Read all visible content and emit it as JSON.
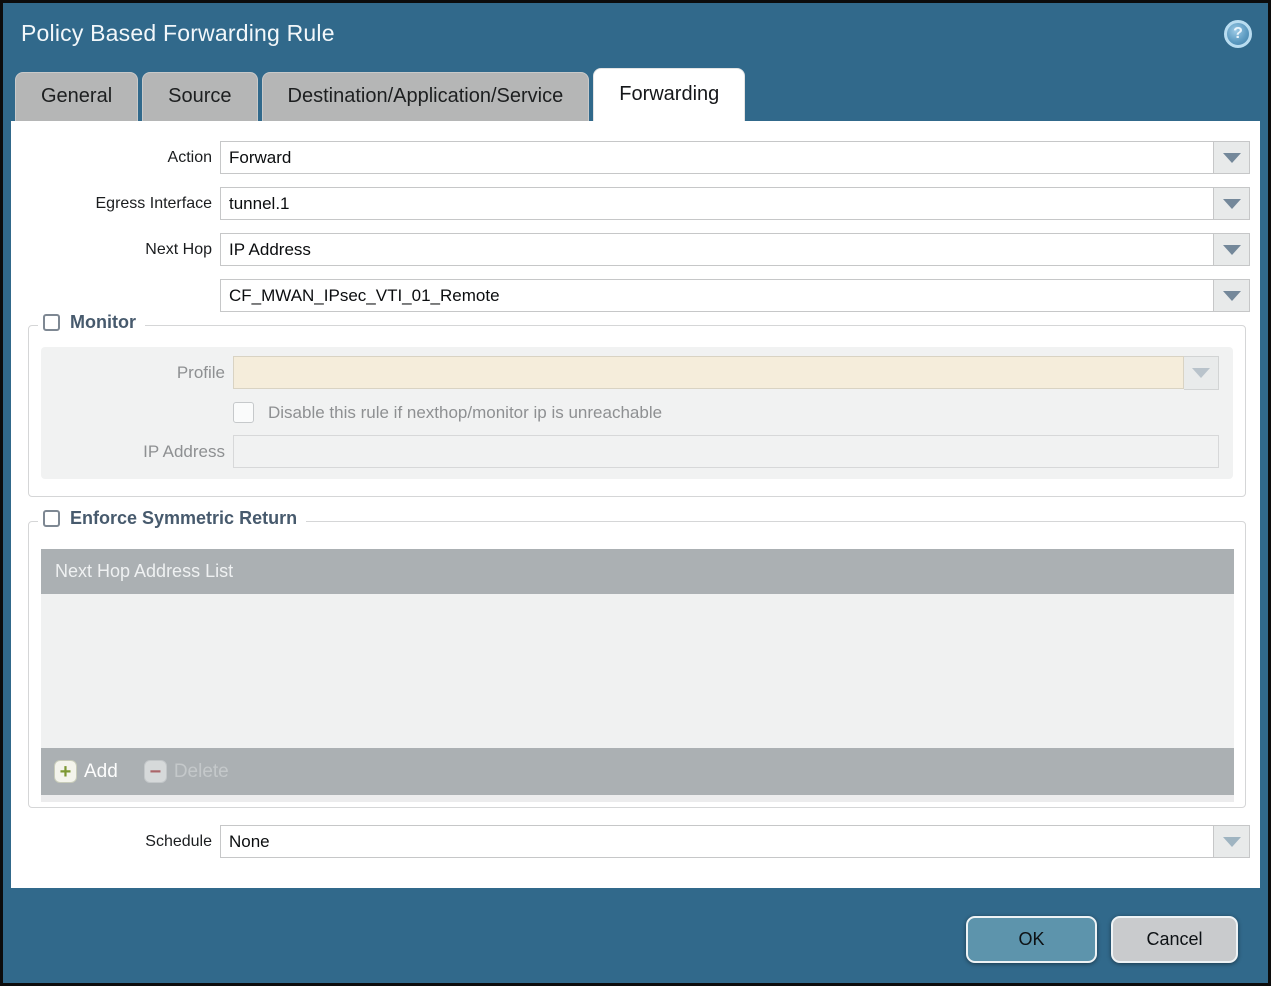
{
  "dialog": {
    "title": "Policy Based Forwarding Rule"
  },
  "icons": {
    "help": "?",
    "dropdown": "chevron-down",
    "add_plus": "+",
    "delete_minus": "−"
  },
  "tabs": [
    {
      "label": "General",
      "active": false
    },
    {
      "label": "Source",
      "active": false
    },
    {
      "label": "Destination/Application/Service",
      "active": false
    },
    {
      "label": "Forwarding",
      "active": true
    }
  ],
  "form": {
    "action_label": "Action",
    "action_value": "Forward",
    "egress_label": "Egress Interface",
    "egress_value": "tunnel.1",
    "next_hop_label": "Next Hop",
    "next_hop_value": "IP Address",
    "next_hop_address_value": "CF_MWAN_IPsec_VTI_01_Remote",
    "schedule_label": "Schedule",
    "schedule_value": "None"
  },
  "monitor": {
    "legend": "Monitor",
    "checked": false,
    "profile_label": "Profile",
    "profile_value": "",
    "disable_label": "Disable this rule if nexthop/monitor ip is unreachable",
    "disable_checked": false,
    "ip_label": "IP Address",
    "ip_value": ""
  },
  "symmetric": {
    "legend": "Enforce Symmetric Return",
    "checked": false,
    "header": "Next Hop Address List",
    "rows": [],
    "add_label": "Add",
    "delete_label": "Delete"
  },
  "footer": {
    "ok_label": "OK",
    "cancel_label": "Cancel"
  },
  "colors": {
    "titlebar": "#31698B",
    "tab_inactive": "#B5B6B6",
    "tab_active": "#FFFFFF",
    "content_bg": "#FFFFFF",
    "legend_text": "#475A6D",
    "panel_bg": "#F1F2F2",
    "profile_disabled_bg": "#F5EDDB",
    "table_header_bg": "#ABB0B3",
    "table_body_bg": "#F0F1F1",
    "add_plus": "#7D9833",
    "delete_minus": "#AB666A",
    "ok_button": "#5D94AC",
    "cancel_button": "#C9CBCD"
  }
}
